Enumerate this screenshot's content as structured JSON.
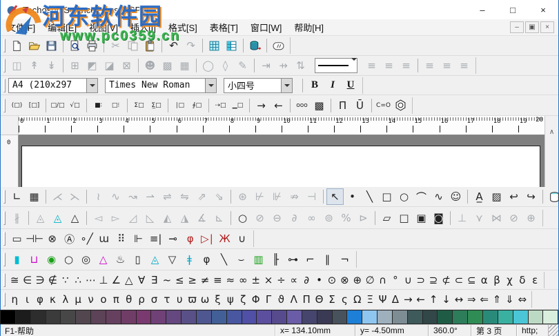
{
  "window": {
    "title": "Techosoft SciencePress - [SP2]",
    "controls": {
      "minimize": "–",
      "maximize": "□",
      "close": "×"
    },
    "mdi_controls": {
      "minimize": "–",
      "restore": "▣",
      "close": "×"
    }
  },
  "watermark": {
    "line1": "河东软件园",
    "line2": "www.pc0359.cn"
  },
  "menu": {
    "items": [
      "文件[F]",
      "编辑[E]",
      "视图[V]",
      "插入[I]",
      "格式[S]",
      "表格[T]",
      "窗口[W]",
      "帮助[H]"
    ]
  },
  "toolbar_standard": {
    "items": [
      {
        "n": "new-document-button",
        "k": "svg"
      },
      {
        "n": "open-button",
        "k": "svg"
      },
      {
        "n": "save-button",
        "k": "svg"
      },
      {
        "sep": true
      },
      {
        "n": "print-preview-button",
        "k": "svg"
      },
      {
        "n": "print-button",
        "k": "svg"
      },
      {
        "sep": true
      },
      {
        "n": "cut-button",
        "g": "✂",
        "e": false
      },
      {
        "n": "copy-button",
        "k": "svg",
        "e": false
      },
      {
        "n": "paste-button",
        "k": "svg"
      },
      {
        "sep": true
      },
      {
        "n": "undo-button",
        "g": "↶"
      },
      {
        "n": "redo-button",
        "g": "↷",
        "e": false
      },
      {
        "sep": true
      },
      {
        "n": "insert-table-button",
        "k": "svg"
      },
      {
        "n": "table-properties-button",
        "k": "svg"
      },
      {
        "sep": true
      },
      {
        "n": "database-button",
        "k": "svg"
      },
      {
        "sep": true
      },
      {
        "n": "comment-button",
        "k": "svg"
      }
    ]
  },
  "toolbar_table": {
    "items": [
      {
        "n": "table-split-button",
        "g": "◫",
        "e": false
      },
      {
        "n": "row-insert-up-button",
        "g": "↟",
        "e": false
      },
      {
        "n": "row-insert-down-button",
        "g": "↡",
        "e": false
      },
      {
        "sep": true
      },
      {
        "n": "borders-all-button",
        "g": "⊞",
        "e": false
      },
      {
        "n": "border-diagonal-down-button",
        "g": "◩",
        "e": false
      },
      {
        "n": "border-diagonal-up-button",
        "g": "◪",
        "e": false
      },
      {
        "n": "border-crosshatch-button",
        "g": "⊠",
        "e": false
      },
      {
        "sep": true
      },
      {
        "n": "portrait-button",
        "g": "☻",
        "e": false
      },
      {
        "n": "shading-button",
        "g": "▩",
        "e": false
      },
      {
        "n": "table-grid-button",
        "g": "▦",
        "e": false
      },
      {
        "sep": true
      },
      {
        "n": "ellipse-fill-button",
        "g": "◯",
        "e": false
      },
      {
        "n": "eraser-button",
        "g": "◊",
        "e": false
      },
      {
        "n": "pen-button",
        "g": "✎",
        "e": false
      },
      {
        "sep": true
      },
      {
        "n": "merge-left-button",
        "g": "⇥",
        "e": false
      },
      {
        "n": "merge-right-button",
        "g": "⇸",
        "e": false
      },
      {
        "n": "wrap-button",
        "g": "⇅",
        "e": false
      }
    ],
    "align_items": [
      {
        "n": "align-left-button",
        "g": "≡",
        "e": false
      },
      {
        "n": "align-center-button",
        "g": "≡",
        "e": false
      },
      {
        "n": "align-right-button",
        "g": "≡",
        "e": false
      },
      {
        "sep": true
      },
      {
        "n": "valign-top-button",
        "g": "≡",
        "e": false
      },
      {
        "n": "valign-middle-button",
        "g": "≡",
        "e": false
      },
      {
        "n": "valign-bottom-button",
        "g": "≡",
        "e": false
      }
    ]
  },
  "format_bar": {
    "page_size": "A4  (210x297",
    "font_name": "Times New Roman",
    "font_size": "小四号",
    "bold_label": "B",
    "italic_label": "I",
    "underline_label": "U"
  },
  "toolbar_templates": {
    "items": [
      {
        "n": "paren-template-button",
        "g": "(□)",
        "s": true
      },
      {
        "n": "bracket-template-button",
        "g": "[□]",
        "s": true
      },
      {
        "sep": true
      },
      {
        "n": "fraction-template-button",
        "g": "□/□",
        "s": true
      },
      {
        "n": "radical-template-button",
        "g": "√□",
        "s": true
      },
      {
        "sep": true
      },
      {
        "n": "subscript-template-button",
        "g": "■∶",
        "s": true
      },
      {
        "n": "supersub-template-button",
        "g": "□⁝",
        "s": true
      },
      {
        "sep": true
      },
      {
        "n": "sum-template-button",
        "g": "Σ□",
        "s": true
      },
      {
        "n": "sum-limits-template-button",
        "g": "Σ̲□",
        "s": true
      },
      {
        "sep": true
      },
      {
        "n": "integral-template-button",
        "g": "∣□",
        "s": true
      },
      {
        "n": "contour-integral-template-button",
        "g": "∮□",
        "s": true
      },
      {
        "sep": true
      },
      {
        "n": "arrow-box-template-button",
        "g": "⇢□",
        "s": true
      },
      {
        "n": "underline-box-template-button",
        "g": "▁□",
        "s": true
      },
      {
        "sep": true
      },
      {
        "n": "reaction-right-button",
        "g": "→"
      },
      {
        "n": "reaction-left-button",
        "g": "←"
      },
      {
        "sep": true
      },
      {
        "n": "matrix-small-button",
        "g": "ooo",
        "s": true
      },
      {
        "n": "matrix-grid-button",
        "g": "▩"
      },
      {
        "sep": true
      },
      {
        "n": "product-bar-button",
        "g": "Π̄"
      },
      {
        "n": "union-bar-button",
        "g": "Ū"
      },
      {
        "sep": true
      },
      {
        "n": "carbonyl-button",
        "g": "C=O",
        "s": true
      },
      {
        "n": "benzene-ring-button",
        "k": "svg"
      }
    ]
  },
  "ruler": {
    "numbers": [
      "0",
      "1",
      "2",
      "3",
      "4",
      "5",
      "6",
      "7",
      "8",
      "9",
      "10",
      "11",
      "12",
      "13",
      "14",
      "15",
      "16",
      "17",
      "18",
      "19",
      "20"
    ],
    "v_label": "0"
  },
  "icons": {
    "scroll_up": "∧"
  },
  "toolbar_draw": {
    "items": [
      {
        "n": "axes-template-button",
        "g": "∟"
      },
      {
        "n": "grid-template-button",
        "g": "▦"
      },
      {
        "sep": true
      },
      {
        "n": "curve-template-1-button",
        "g": "⋌",
        "e": false
      },
      {
        "n": "curve-template-2-button",
        "g": "⋋",
        "e": false
      },
      {
        "sep": true
      },
      {
        "n": "curve-template-3-button",
        "g": "≀",
        "e": false
      },
      {
        "n": "curve-template-4-button",
        "g": "∿",
        "e": false
      },
      {
        "n": "curve-template-5-button",
        "g": "↝",
        "e": false
      },
      {
        "n": "curve-template-6-button",
        "g": "⇀",
        "e": false
      },
      {
        "n": "curve-template-7-button",
        "g": "⇌",
        "e": false
      },
      {
        "n": "curve-template-8-button",
        "g": "⇋",
        "e": false
      },
      {
        "n": "curve-template-9-button",
        "g": "⇗",
        "e": false
      },
      {
        "n": "curve-template-10-button",
        "g": "⇘",
        "e": false
      },
      {
        "sep": true
      },
      {
        "n": "axis-extra-1-button",
        "g": "⊛",
        "e": false
      },
      {
        "n": "axis-extra-2-button",
        "g": "⊬",
        "e": false
      },
      {
        "n": "axis-extra-3-button",
        "g": "⊮",
        "e": false
      },
      {
        "n": "axis-extra-4-button",
        "g": "⇏",
        "e": false
      },
      {
        "n": "axis-extra-5-button",
        "g": "⊣",
        "e": false
      },
      {
        "sep": true
      },
      {
        "n": "pointer-tool",
        "g": "↖",
        "p": true
      },
      {
        "n": "point-tool",
        "g": "•"
      },
      {
        "n": "line-tool",
        "g": "╲"
      },
      {
        "n": "rectangle-tool",
        "g": "□"
      },
      {
        "n": "ellipse-tool",
        "g": "○"
      },
      {
        "n": "arc-tool",
        "g": "⌒"
      },
      {
        "n": "curve-tool",
        "g": "∿"
      },
      {
        "n": "face-tool",
        "g": "☺"
      },
      {
        "sep": true
      },
      {
        "n": "text-tool",
        "g": "A̲"
      },
      {
        "n": "hatch-tool",
        "g": "▨"
      },
      {
        "n": "hook-arrow-left-tool",
        "g": "↩"
      },
      {
        "n": "hook-arrow-right-tool",
        "g": "↪"
      },
      {
        "sep": true
      },
      {
        "n": "cylinder-3d-button",
        "k": "svg"
      },
      {
        "n": "cube-3d-button",
        "k": "svg"
      },
      {
        "n": "sphere-3d-button",
        "k": "svg"
      },
      {
        "n": "cone-3d-button",
        "k": "svg"
      }
    ]
  },
  "toolbar_geometry": {
    "items": [
      {
        "n": "strike-parallel-button",
        "g": "∦",
        "e": false
      },
      {
        "sep": true
      },
      {
        "n": "triangle-dotted-button",
        "g": "◬",
        "e": false
      },
      {
        "n": "triangle-vertex-button",
        "g": "◬",
        "c": "#00b2c8"
      },
      {
        "n": "triangle-button",
        "g": "△"
      },
      {
        "sep": true
      },
      {
        "n": "triangle-var-1-button",
        "g": "◅",
        "e": false
      },
      {
        "n": "triangle-var-2-button",
        "g": "▻",
        "e": false
      },
      {
        "n": "triangle-var-3-button",
        "g": "◿",
        "e": false
      },
      {
        "n": "triangle-var-4-button",
        "g": "◺",
        "e": false
      },
      {
        "n": "triangle-var-5-button",
        "g": "◭",
        "e": false
      },
      {
        "n": "triangle-var-6-button",
        "g": "◮",
        "e": false
      },
      {
        "n": "triangle-var-7-button",
        "g": "∡",
        "e": false
      },
      {
        "n": "triangle-var-8-button",
        "g": "⊾",
        "e": false
      },
      {
        "sep": true
      },
      {
        "n": "circle-button",
        "g": "○"
      },
      {
        "n": "circle-var-1-button",
        "g": "⊘",
        "e": false
      },
      {
        "n": "circle-var-2-button",
        "g": "⊖",
        "e": false
      },
      {
        "n": "circle-var-3-button",
        "g": "∂",
        "e": false
      },
      {
        "n": "circle-var-4-button",
        "g": "∞",
        "e": false
      },
      {
        "n": "circle-var-5-button",
        "g": "⊚",
        "e": false
      },
      {
        "n": "circle-var-6-button",
        "g": "%",
        "e": false
      },
      {
        "n": "circle-var-7-button",
        "g": "⊳",
        "e": false
      },
      {
        "sep": true
      },
      {
        "n": "parallelogram-button",
        "g": "▱"
      },
      {
        "n": "square-button",
        "g": "□"
      },
      {
        "n": "square-inset-button",
        "g": "▣"
      },
      {
        "n": "circle-in-square-button",
        "g": "◙"
      },
      {
        "sep": true
      },
      {
        "n": "perpendicular-button",
        "g": "⊥",
        "e": false
      },
      {
        "n": "angle-mark-button",
        "g": "⋎",
        "e": false
      },
      {
        "n": "cross-square-button",
        "g": "⋈",
        "e": false
      },
      {
        "n": "circle-slash-button",
        "g": "⊘",
        "e": false
      },
      {
        "n": "circle-plus-button",
        "g": "⊕",
        "e": false
      }
    ]
  },
  "toolbar_circuit": {
    "items": [
      {
        "n": "resistor-symbol-button",
        "g": "▭"
      },
      {
        "n": "capacitor-symbol-button",
        "g": "⊣⊢"
      },
      {
        "n": "lamp-symbol-button",
        "g": "⊗"
      },
      {
        "n": "ammeter-symbol-button",
        "g": "Ⓐ"
      },
      {
        "n": "switch-symbol-button",
        "g": "∘╱"
      },
      {
        "n": "inductor-symbol-button",
        "g": "ɯ"
      },
      {
        "n": "dot-grid-symbol-button",
        "g": "⠿"
      },
      {
        "n": "capacitor2-symbol-button",
        "g": "⊩"
      },
      {
        "n": "battery-symbol-button",
        "g": "≡|"
      },
      {
        "n": "rheostat-symbol-button",
        "g": "⊸"
      },
      {
        "n": "bell-symbol-button",
        "g": "φ",
        "c": "#b02020"
      },
      {
        "n": "diode-symbol-button",
        "g": "▷∣",
        "c": "#b02020"
      },
      {
        "n": "transformer-symbol-button",
        "g": "Ж",
        "c": "#b02020"
      },
      {
        "n": "magnet-symbol-button",
        "g": "∪"
      }
    ]
  },
  "toolbar_chemistry": {
    "items": [
      {
        "n": "test-tube-tool",
        "g": "▮",
        "c": "#00bcd4"
      },
      {
        "n": "beaker-tool",
        "g": "⊔",
        "c": "#cc00cc"
      },
      {
        "n": "flask-green-tool",
        "g": "◉",
        "c": "#18a018"
      },
      {
        "n": "flask-round-tool",
        "g": "○"
      },
      {
        "n": "flask-flat-tool",
        "g": "◎"
      },
      {
        "n": "flask-conical-tool",
        "g": "△",
        "c": "#cc00cc"
      },
      {
        "n": "alcohol-burner-tool",
        "g": "♨"
      },
      {
        "n": "bottle-tool",
        "g": "▯"
      },
      {
        "n": "dropper-bottle-tool",
        "g": "◬",
        "c": "#00a8c8"
      },
      {
        "n": "funnel-tool",
        "g": "▽"
      },
      {
        "n": "thermometer-tool",
        "g": "ǂ",
        "c": "#00a8c8"
      },
      {
        "n": "pipette-tool",
        "g": "φ"
      },
      {
        "n": "glass-rod-tool",
        "g": "╲"
      },
      {
        "n": "evaporating-dish-tool",
        "g": "⌣"
      },
      {
        "n": "measuring-cylinder-tool",
        "g": "▥",
        "c": "#18a018"
      },
      {
        "n": "iron-stand-tool",
        "g": "╟"
      },
      {
        "n": "connector-tube-tool",
        "g": "⊶"
      },
      {
        "n": "bent-tube-tool",
        "g": "⌐"
      },
      {
        "n": "parallel-tube-tool",
        "g": "∥"
      },
      {
        "n": "bent-tube-2-tool",
        "g": "¬"
      }
    ]
  },
  "symbols_math": [
    "≅",
    "∈",
    "∋",
    "∉",
    "∵",
    "∴",
    "⋯",
    "⊥",
    "∠",
    "△",
    "∀",
    "∃",
    "~",
    "≤",
    "≥",
    "≠",
    "≡",
    "≈",
    "∞",
    "±",
    "×",
    "÷",
    "∝",
    "∂",
    "•",
    "⊙",
    "⊗",
    "⊕",
    "∅",
    "∩",
    "°",
    "∪",
    "⊃",
    "⊇",
    "⊄",
    "⊂",
    "⊆",
    "α",
    "β",
    "χ",
    "δ",
    "ε"
  ],
  "symbols_greek": [
    "η",
    "ι",
    "φ",
    "κ",
    "λ",
    "μ",
    "ν",
    "ο",
    "π",
    "θ",
    "ρ",
    "σ",
    "τ",
    "υ",
    "ϖ",
    "ω",
    "ξ",
    "ψ",
    "ζ",
    "Φ",
    "Γ",
    "ϑ",
    "Λ",
    "Π",
    "Θ",
    "Σ",
    "ς",
    "Ω",
    "Ξ",
    "Ψ",
    "Δ",
    "→",
    "←",
    "↑",
    "↓",
    "↔",
    "⇒",
    "⇐",
    "⇑",
    "⇓",
    "⇔"
  ],
  "palette": [
    "#000000",
    "#1c1c1c",
    "#2d2d2d",
    "#3b3b3b",
    "#474747",
    "#52464f",
    "#5c4357",
    "#66405f",
    "#703d67",
    "#7a3a6f",
    "#6f4177",
    "#64487f",
    "#595087",
    "#4e578f",
    "#435f97",
    "#48579f",
    "#5050a7",
    "#5b4f9e",
    "#574b8e",
    "#6a5ca6",
    "#45456e",
    "#3a3a55",
    "#47525c",
    "#1e7fd6",
    "#8ec6f0",
    "#9fb0bd",
    "#7e8c94",
    "#3f5a5a",
    "#324747",
    "#1f5c46",
    "#2e7d5a",
    "#2f8c54",
    "#2a8a7a",
    "#39b0a0",
    "#4ac6d6",
    "#bcd9c4",
    "#d9eedd"
  ],
  "status": {
    "message": "F1-帮助",
    "x": "x= 134.10mm",
    "y": "y= -4.50mm",
    "angle": "360.0°",
    "page": "第 3 页",
    "protocol": "http;"
  }
}
